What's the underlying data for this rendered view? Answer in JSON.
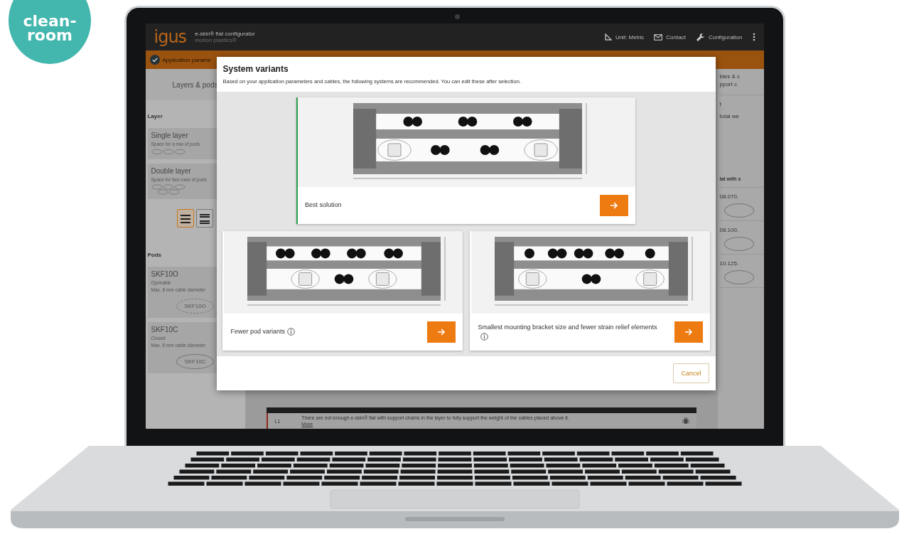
{
  "badge": {
    "lines": [
      "clean-",
      "room"
    ]
  },
  "app_bar": {
    "logo": "igus",
    "title": "e-skin® flat configurator",
    "subtitle": "motion plastics®",
    "actions": [
      {
        "label": "Unit: Metric"
      },
      {
        "label": "Contact"
      },
      {
        "label": "Configuration"
      }
    ]
  },
  "stepper": {
    "label": "Application parame",
    "completed": true
  },
  "sidebar": {
    "tab": "Layers & pods",
    "layer_heading": "Layer",
    "layers": [
      {
        "title": "Single layer",
        "description": "Space for a row of pods",
        "kind": "single"
      },
      {
        "title": "Double layer",
        "description": "Space for two rows of pods",
        "kind": "double"
      }
    ],
    "view_toggles": [
      {
        "kind": "spaced",
        "selected": true
      },
      {
        "kind": "compact",
        "selected": false
      }
    ],
    "pods_heading": "Pods",
    "pods": [
      {
        "name": "SKF10O",
        "type": "Openable",
        "spec": "Max. 8 mm cable diameter",
        "badge": "SKF10O",
        "kind": "dashed"
      },
      {
        "name": "SKF10C",
        "type": "Closed",
        "spec": "Max. 8 mm cable diameter",
        "badge": "SKF10C",
        "kind": "solid"
      }
    ]
  },
  "right_panel": {
    "heading_lines": [
      "bles & c",
      "pport c"
    ],
    "fragment": "t",
    "weight": "total we",
    "section": "lat with s",
    "items": [
      "08.070.",
      "08.100.",
      "10.125."
    ]
  },
  "warning": {
    "layer": "L1",
    "message": "There are not enough e-skin® flat with support chains in the layer to fully support the weight of the cables placed above it.",
    "link": "More"
  },
  "dialog": {
    "title": "System variants",
    "description": "Based on your application parameters and cables, the following systems are recommended. You can edit these after selection.",
    "variants": [
      {
        "label": "Best solution",
        "selected": true,
        "info": false,
        "kind": "balanced"
      },
      {
        "label": "Fewer pod variants",
        "selected": false,
        "info": true,
        "kind": "wide"
      },
      {
        "label": "Smallest mounting bracket size and fewer strain relief elements",
        "selected": false,
        "info": true,
        "kind": "compact"
      }
    ],
    "cancel": "Cancel"
  }
}
